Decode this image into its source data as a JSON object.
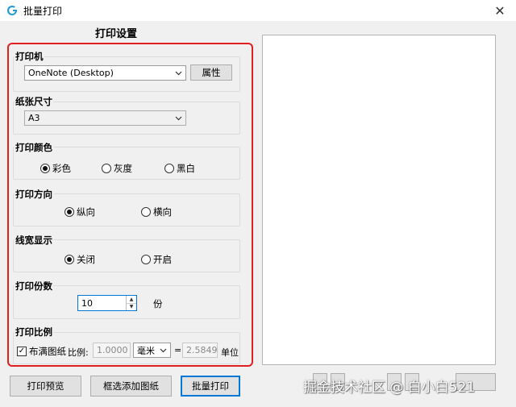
{
  "window": {
    "title": "批量打印",
    "close": "✕"
  },
  "settings_title": "打印设置",
  "printer": {
    "label": "打印机",
    "value": "OneNote (Desktop)",
    "properties_button": "属性"
  },
  "paper": {
    "label": "纸张尺寸",
    "value": "A3"
  },
  "color": {
    "label": "打印颜色",
    "options": [
      "彩色",
      "灰度",
      "黑白"
    ],
    "selected": 0
  },
  "orientation": {
    "label": "打印方向",
    "options": [
      "纵向",
      "横向"
    ],
    "selected": 0
  },
  "line_width": {
    "label": "线宽显示",
    "options": [
      "关闭",
      "开启"
    ],
    "selected": 0
  },
  "copies": {
    "label": "打印份数",
    "value": "10",
    "unit": "份"
  },
  "scale": {
    "label": "打印比例",
    "fit_paper": "布满图纸",
    "ratio_label": "比例:",
    "ratio_value": "1.0000",
    "unit_select": "毫米",
    "equals": "=",
    "unit_value": "2.5849",
    "unit_label": "单位"
  },
  "buttons": {
    "preview": "打印预览",
    "add_drawings": "框选添加图纸",
    "batch_print": "批量打印"
  },
  "watermark": "掘金技术社区 @ 白小白521"
}
